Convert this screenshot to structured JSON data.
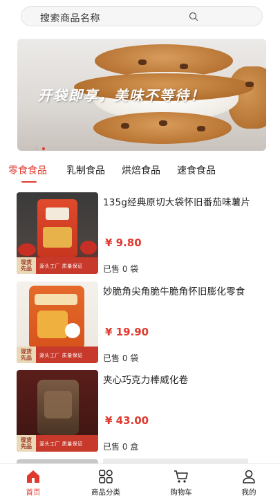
{
  "search": {
    "placeholder": "搜索商品名称"
  },
  "banner": {
    "slogan": "开袋即享，美味不等待！",
    "indicator_count": 2,
    "active_index": 1
  },
  "tabs": [
    {
      "label": "零食食品",
      "active": true
    },
    {
      "label": "乳制食品",
      "active": false
    },
    {
      "label": "烘焙食品",
      "active": false
    },
    {
      "label": "速食食品",
      "active": false
    }
  ],
  "products": [
    {
      "name": "135g经典原切大袋怀旧番茄味薯片",
      "price": "¥ 9.80",
      "sold": "已售 0 袋",
      "badge": "现货 先品",
      "badge_slogan": "源头工厂 质量保证"
    },
    {
      "name": "妙脆角尖角脆牛脆角怀旧膨化零食",
      "price": "¥ 19.90",
      "sold": "已售 0 袋",
      "badge": "现货 先品",
      "badge_slogan": "源头工厂 质量保证"
    },
    {
      "name": "夹心巧克力棒威化卷",
      "price": "¥ 43.00",
      "sold": "已售 0 盒",
      "badge": "现货 先品",
      "badge_slogan": "源头工厂 质量保证"
    }
  ],
  "tabbar": [
    {
      "label": "首页",
      "icon": "home-icon",
      "active": true
    },
    {
      "label": "商品分类",
      "icon": "category-icon",
      "active": false
    },
    {
      "label": "购物车",
      "icon": "cart-icon",
      "active": false
    },
    {
      "label": "我的",
      "icon": "user-icon",
      "active": false
    }
  ],
  "colors": {
    "accent": "#e03a2f",
    "badge_red": "#c7392b",
    "search_bg": "#f6f6f6"
  }
}
